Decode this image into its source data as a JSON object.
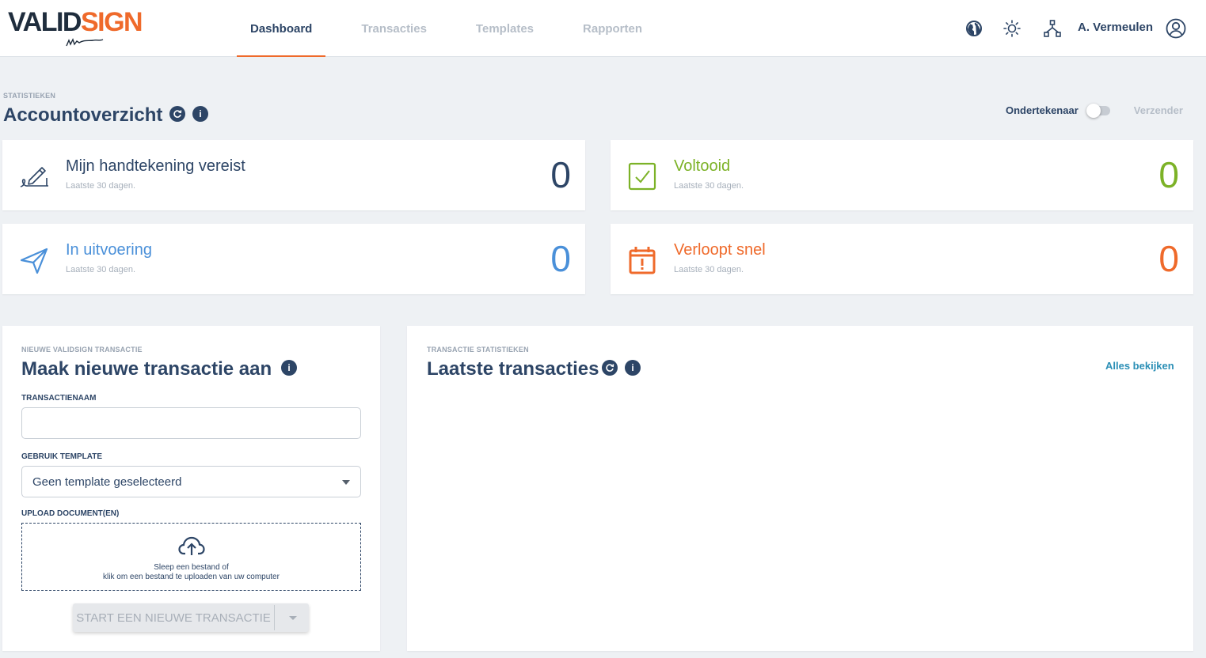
{
  "brand": {
    "part1": "VALID",
    "part2": "SIGN"
  },
  "nav": {
    "items": [
      {
        "label": "Dashboard",
        "active": true
      },
      {
        "label": "Transacties",
        "active": false
      },
      {
        "label": "Templates",
        "active": false
      },
      {
        "label": "Rapporten",
        "active": false
      }
    ]
  },
  "header": {
    "icons": [
      "globe-icon",
      "brightness-icon",
      "network-icon",
      "user-circle-icon"
    ],
    "user_name": "A. Vermeulen"
  },
  "stats": {
    "eyebrow": "STATISTIEKEN",
    "title": "Accountoverzicht",
    "toggle_left": "Ondertekenaar",
    "toggle_right": "Verzender",
    "cards": [
      {
        "title": "Mijn handtekening vereist",
        "subtitle": "Laatste 30 dagen.",
        "value": "0",
        "color": "#2d4566",
        "icon": "signature-icon"
      },
      {
        "title": "Voltooid",
        "subtitle": "Laatste 30 dagen.",
        "value": "0",
        "color": "#7cb227",
        "icon": "checkbox-icon"
      },
      {
        "title": "In uitvoering",
        "subtitle": "Laatste 30 dagen.",
        "value": "0",
        "color": "#4a90d9",
        "icon": "paper-plane-icon"
      },
      {
        "title": "Verloopt snel",
        "subtitle": "Laatste 30 dagen.",
        "value": "0",
        "color": "#ef6a2b",
        "icon": "calendar-alert-icon"
      }
    ]
  },
  "new_transaction": {
    "eyebrow": "NIEUWE VALIDSIGN TRANSACTIE",
    "title": "Maak nieuwe transactie aan",
    "name_label": "TRANSACTIENAAM",
    "name_value": "",
    "template_label": "GEBRUIK TEMPLATE",
    "template_value": "Geen template geselecteerd",
    "upload_label": "UPLOAD DOCUMENT(EN)",
    "upload_line1": "Sleep een bestand of",
    "upload_line2": "klik om een bestand te uploaden van uw computer",
    "start_button": "START EEN NIEUWE TRANSACTIE"
  },
  "latest": {
    "eyebrow": "TRANSACTIE STATISTIEKEN",
    "title": "Laatste transacties",
    "view_all": "Alles bekijken"
  },
  "colors": {
    "accent": "#ef6a2b",
    "primary": "#2d4566",
    "link": "#2b8fb6",
    "success": "#7cb227",
    "info": "#4a90d9"
  }
}
